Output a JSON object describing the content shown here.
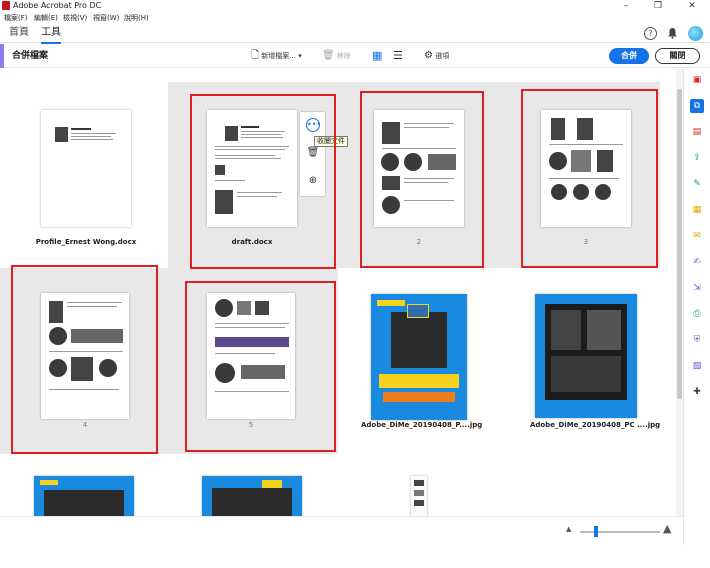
{
  "window": {
    "title": "Adobe Acrobat Pro DC",
    "minimize": "–",
    "restore": "❐",
    "close": "✕"
  },
  "menu": [
    "檔案(F)",
    "編輯(E)",
    "檢視(V)",
    "視窗(W)",
    "說明(H)"
  ],
  "tabs": [
    {
      "label": "首頁"
    },
    {
      "label": "工具"
    }
  ],
  "header_icons": {
    "help": "?",
    "bell": "🔔"
  },
  "toolbar": {
    "title": "合併檔案",
    "add_files": "新增檔案...",
    "remove": "移除",
    "options": "選項",
    "merge_button": "合併",
    "close_button": "關閉"
  },
  "thumbnails": [
    {
      "label": "Profile_Ernest Wong.docx"
    },
    {
      "label": "draft.docx"
    },
    {
      "label": "2"
    },
    {
      "label": "3"
    },
    {
      "label": "4"
    },
    {
      "label": "5"
    },
    {
      "label": "Adobe_DiMe_20190408_P....jpg"
    },
    {
      "label": "Adobe_DiMe_20190408_PC ....jpg"
    }
  ],
  "hover_tools": {
    "tooltip": "收闔文件"
  },
  "colors": {
    "accent_blue": "#1473e6",
    "highlight_red": "#e02020",
    "group_bg": "#e8e8e8",
    "tool_accent": "#8b7cf6"
  }
}
